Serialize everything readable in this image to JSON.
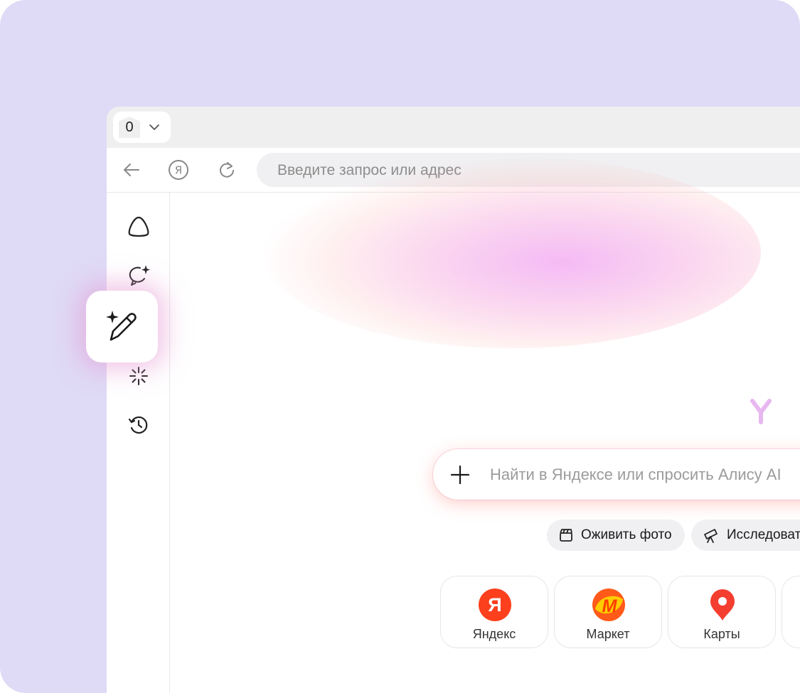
{
  "browser": {
    "tab_count": "0",
    "address_placeholder": "Введите запрос или адрес",
    "toolbar_icons": [
      "back-arrow-icon",
      "yandex-circle-icon",
      "reload-icon"
    ]
  },
  "sidebar": {
    "items": [
      {
        "icon": "alice-icon"
      },
      {
        "icon": "chat-sparkle-icon"
      },
      {
        "icon": "magic-pen-icon",
        "active": true
      },
      {
        "icon": "sparkle-burst-icon"
      },
      {
        "icon": "history-icon"
      }
    ]
  },
  "main": {
    "search_placeholder": "Найти в Яндексе или спросить Алису AI",
    "chips": [
      {
        "label": "Оживить фото",
        "icon": "clapperboard-icon"
      },
      {
        "label": "Исследоват",
        "icon": "telescope-icon"
      }
    ],
    "tiles": [
      {
        "label": "Яндекс",
        "icon": "yandex-logo-icon",
        "color": "#fc3f1d"
      },
      {
        "label": "Маркет",
        "icon": "market-logo-icon",
        "color": "#ffcc00"
      },
      {
        "label": "Карты",
        "icon": "maps-pin-icon",
        "color": "#f43e2f"
      }
    ]
  },
  "colors": {
    "frame_bg": "#dfdaf6",
    "accent_glow": "#ec82ec"
  }
}
